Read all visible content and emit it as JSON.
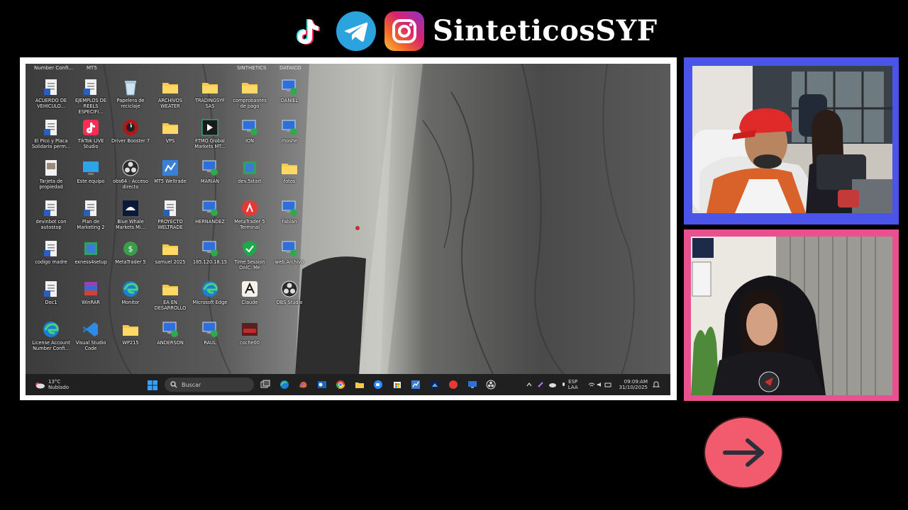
{
  "header": {
    "brand": "SinteticosSYF",
    "icons": [
      "tiktok-icon",
      "telegram-icon",
      "instagram-icon"
    ]
  },
  "desktop": {
    "top_labels": [
      "Number Confi...",
      "MT5",
      "SINTHETICS",
      "DATAICO"
    ],
    "icons": [
      {
        "label": "ACUERDO DE\nVEHICULO...",
        "icon": "word-doc-icon"
      },
      {
        "label": "EJEMPLOS DE\nREELS ESPECIFI...",
        "icon": "word-doc-icon"
      },
      {
        "label": "Papelera de\nreciclaje",
        "icon": "recycle-bin-icon"
      },
      {
        "label": "ARCHIVOS\nWEATER",
        "icon": "folder-icon"
      },
      {
        "label": "TRADINGSYF SAS",
        "icon": "folder-icon"
      },
      {
        "label": "comprobantes\nde pago",
        "icon": "folder-icon"
      },
      {
        "label": "DANIEL",
        "icon": "remote-desktop-icon"
      },
      {
        "label": "El Pico y Placa\nSolidario perm...",
        "icon": "word-doc-icon"
      },
      {
        "label": "TikTok LIVE\nStudio",
        "icon": "tiktok-live-icon"
      },
      {
        "label": "Driver Booster 7",
        "icon": "driver-booster-icon"
      },
      {
        "label": "VPS",
        "icon": "folder-icon"
      },
      {
        "label": "FTMO Global\nMarkets MT...",
        "icon": "ftmo-icon"
      },
      {
        "label": "ION",
        "icon": "remote-desktop-icon"
      },
      {
        "label": "moshe",
        "icon": "remote-desktop-icon"
      },
      {
        "label": "Tarjeta de\npropiedad",
        "icon": "doc-image-icon"
      },
      {
        "label": "Este equipo",
        "icon": "this-pc-icon"
      },
      {
        "label": "obs64 - Acceso\ndirecto",
        "icon": "obs-icon"
      },
      {
        "label": "MT5 Weltrade",
        "icon": "mt5-icon"
      },
      {
        "label": "MARIAN",
        "icon": "remote-desktop-icon"
      },
      {
        "label": "dev.5start",
        "icon": "installer-icon"
      },
      {
        "label": "fotos",
        "icon": "folder-icon"
      },
      {
        "label": "devinbot con\nautostop",
        "icon": "word-doc-icon"
      },
      {
        "label": "Plan de\nMarketing 2",
        "icon": "word-doc-icon"
      },
      {
        "label": "Blue Whale\nMarkets Mi...",
        "icon": "blue-whale-icon"
      },
      {
        "label": "PROYECTO\nWELTRADE",
        "icon": "word-doc-icon"
      },
      {
        "label": "HERNANDEZ",
        "icon": "remote-desktop-icon"
      },
      {
        "label": "MetaTrader 5\nTerminal",
        "icon": "metatrader-red-icon"
      },
      {
        "label": "fabian",
        "icon": "remote-desktop-icon"
      },
      {
        "label": "codigo madre",
        "icon": "word-doc-icon"
      },
      {
        "label": "exness4setup",
        "icon": "installer-icon"
      },
      {
        "label": "MetaTrader 5",
        "icon": "metatrader-icon"
      },
      {
        "label": "samuel 2025",
        "icon": "folder-icon"
      },
      {
        "label": "185.120.18.15",
        "icon": "remote-desktop-icon"
      },
      {
        "label": "Time Session\nOnlC. Me",
        "icon": "shield-icon"
      },
      {
        "label": "web.Archivo",
        "icon": "remote-desktop-icon"
      },
      {
        "label": "Doc1",
        "icon": "word-doc-icon"
      },
      {
        "label": "WinRAR",
        "icon": "winrar-icon"
      },
      {
        "label": "Monitor",
        "icon": "edge-icon"
      },
      {
        "label": "EA EN\nDESARROLLO",
        "icon": "folder-icon"
      },
      {
        "label": "Microsoft Edge",
        "icon": "edge-icon"
      },
      {
        "label": "Claude",
        "icon": "claude-icon"
      },
      {
        "label": "OBS Studio",
        "icon": "obs-icon"
      },
      {
        "label": "License Account\nNumber Confi...",
        "icon": "edge-icon"
      },
      {
        "label": "Visual Studio\nCode",
        "icon": "vscode-icon"
      },
      {
        "label": "WP215",
        "icon": "folder-icon"
      },
      {
        "label": "ANDERSON",
        "icon": "remote-desktop-icon"
      },
      {
        "label": "RAUL",
        "icon": "remote-desktop-icon"
      },
      {
        "label": "coche00",
        "icon": "car-image-icon"
      }
    ]
  },
  "taskbar": {
    "weather_temp": "13°C",
    "weather_desc": "Nublado",
    "search_placeholder": "Buscar",
    "lang_top": "ESP",
    "lang_bottom": "LAA",
    "time": "09:09:AM",
    "date": "31/10/2025",
    "apps": [
      "task-view-icon",
      "edge-icon",
      "copilot-icon",
      "outlook-icon",
      "chrome-icon",
      "explorer-icon",
      "zoom-icon",
      "store-icon",
      "mt5-icon",
      "photos-icon",
      "metatrader-red-icon",
      "remote-desktop-icon",
      "obs-icon"
    ],
    "colors": {
      "taskbar_bg": "#202020"
    }
  },
  "colors": {
    "cam1_border": "#4a54e8",
    "cam2_border": "#ea4f8f",
    "next_button": "#f15b6d"
  }
}
